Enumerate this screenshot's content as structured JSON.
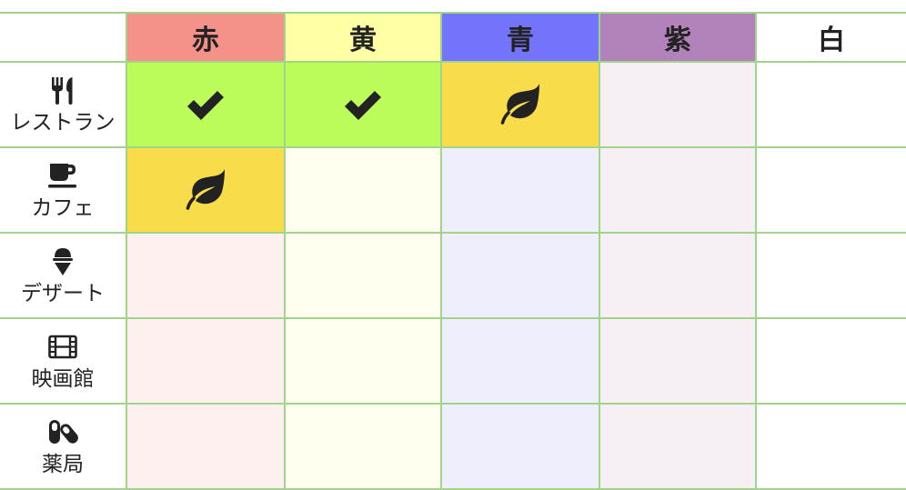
{
  "columns": [
    {
      "label": "赤",
      "color": "#f4928a"
    },
    {
      "label": "黄",
      "color": "#ffffa6"
    },
    {
      "label": "青",
      "color": "#7474fa"
    },
    {
      "label": "紫",
      "color": "#b282bb"
    },
    {
      "label": "白",
      "color": "#ffffff"
    }
  ],
  "rows": [
    {
      "label": "レストラン",
      "icon": "utensils-icon",
      "cells": [
        "check-icon",
        "check-icon",
        "leaf-icon",
        "",
        ""
      ]
    },
    {
      "label": "カフェ",
      "icon": "coffee-cup-icon",
      "cells": [
        "leaf-icon",
        "",
        "",
        "",
        ""
      ]
    },
    {
      "label": "デザート",
      "icon": "ice-cream-icon",
      "cells": [
        "",
        "",
        "",
        "",
        ""
      ]
    },
    {
      "label": "映画館",
      "icon": "film-icon",
      "cells": [
        "",
        "",
        "",
        "",
        ""
      ]
    },
    {
      "label": "薬局",
      "icon": "pills-icon",
      "cells": [
        "",
        "",
        "",
        "",
        ""
      ]
    }
  ],
  "colors": {
    "grid": "#9fd48a",
    "check_cell": "#bbfc5a",
    "leaf_cell": "#f8dc4a"
  }
}
